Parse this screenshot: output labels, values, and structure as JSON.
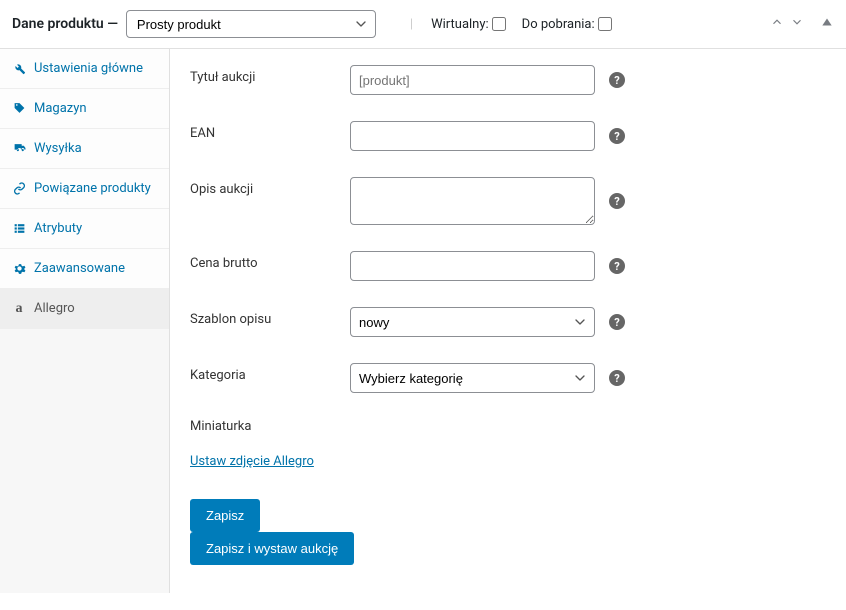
{
  "header": {
    "title": "Dane produktu —",
    "product_type": "Prosty produkt",
    "virtual_label": "Wirtualny:",
    "downloadable_label": "Do pobrania:"
  },
  "sidebar": {
    "items": [
      {
        "label": "Ustawienia główne",
        "icon": "wrench"
      },
      {
        "label": "Magazyn",
        "icon": "tag"
      },
      {
        "label": "Wysyłka",
        "icon": "truck"
      },
      {
        "label": "Powiązane produkty",
        "icon": "link"
      },
      {
        "label": "Atrybuty",
        "icon": "list"
      },
      {
        "label": "Zaawansowane",
        "icon": "gear"
      },
      {
        "label": "Allegro",
        "icon": "allegro"
      }
    ]
  },
  "form": {
    "title_label": "Tytuł aukcji",
    "title_placeholder": "[produkt]",
    "ean_label": "EAN",
    "desc_label": "Opis aukcji",
    "price_label": "Cena brutto",
    "template_label": "Szablon opisu",
    "template_value": "nowy",
    "category_label": "Kategoria",
    "category_value": "Wybierz kategorię",
    "thumbnail_label": "Miniaturka",
    "set_image_link": "Ustaw zdjęcie Allegro",
    "save_label": "Zapisz",
    "save_publish_label": "Zapisz i wystaw aukcję"
  }
}
